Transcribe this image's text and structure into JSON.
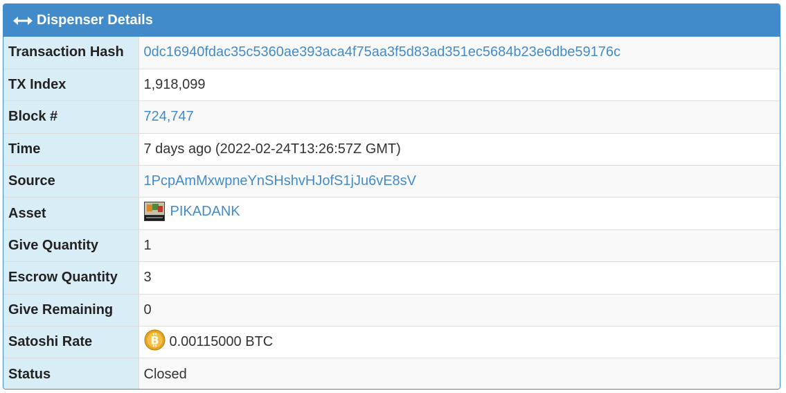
{
  "panel": {
    "title": "Dispenser Details",
    "title_icon": "left-right-arrow-icon",
    "accent_color": "#428bca",
    "label_bg_color": "#d9edf7"
  },
  "rows": {
    "tx_hash": {
      "label": "Transaction Hash",
      "value": "0dc16940fdac35c5360ae393aca4f75aa3f5d83ad351ec5684b23e6dbe59176c"
    },
    "tx_index": {
      "label": "TX Index",
      "value": "1,918,099"
    },
    "block": {
      "label": "Block #",
      "value": "724,747"
    },
    "time": {
      "label": "Time",
      "value": "7 days ago (2022-02-24T13:26:57Z GMT)"
    },
    "source": {
      "label": "Source",
      "value": "1PcpAmMxwpneYnSHshvHJofS1jJu6vE8sV"
    },
    "asset": {
      "label": "Asset",
      "value": "PIKADANK",
      "icon": "asset-thumbnail-icon"
    },
    "give_quantity": {
      "label": "Give Quantity",
      "value": "1"
    },
    "escrow_quantity": {
      "label": "Escrow Quantity",
      "value": "3"
    },
    "give_remaining": {
      "label": "Give Remaining",
      "value": "0"
    },
    "satoshi_rate": {
      "label": "Satoshi Rate",
      "value": "0.00115000 BTC",
      "icon": "bitcoin-icon"
    },
    "status": {
      "label": "Status",
      "value": "Closed"
    }
  }
}
